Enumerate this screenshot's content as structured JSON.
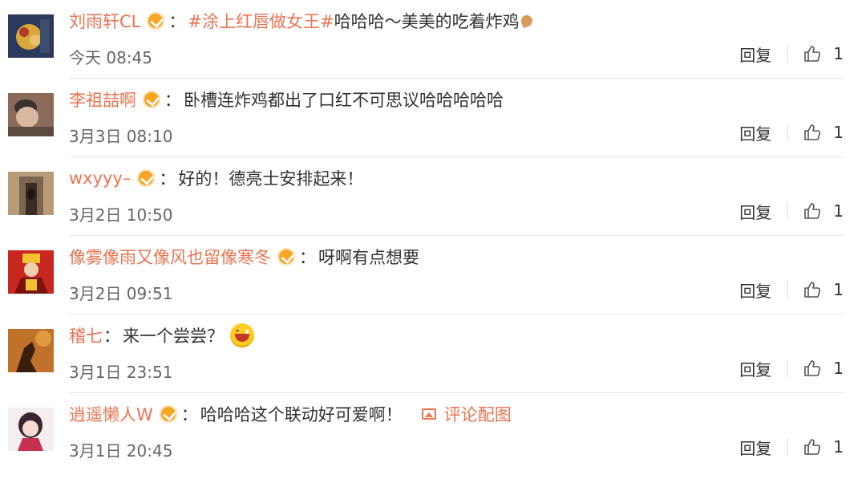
{
  "comments": [
    {
      "user": "刘雨轩CL",
      "topic": "#涂上红唇做女王#",
      "text": "哈哈哈～美美的吃着炸鸡",
      "time": "今天 08:45",
      "reply": "回复",
      "likes": "1",
      "avatar_colors": [
        "#2b3a5c",
        "#d9a63a",
        "#b33a2a"
      ]
    },
    {
      "user": "李祖喆啊",
      "text": "卧槽连炸鸡都出了口红不可思议哈哈哈哈哈",
      "time": "3月3日 08:10",
      "reply": "回复",
      "likes": "1",
      "avatar_colors": [
        "#8a6b5a",
        "#d8b8a0",
        "#3a3030"
      ]
    },
    {
      "user": "wxyyy–",
      "text": "好的！德亮士安排起来！",
      "time": "3月2日 10:50",
      "reply": "回复",
      "likes": "1",
      "avatar_colors": [
        "#7a6650",
        "#3a2c22",
        "#b89c78"
      ]
    },
    {
      "user": "像雾像雨又像风也留像寒冬",
      "text": "呀啊有点想要",
      "time": "3月2日 09:51",
      "reply": "回复",
      "likes": "1",
      "avatar_colors": [
        "#c8261e",
        "#f2c230",
        "#7a1410"
      ]
    },
    {
      "user": "稽七",
      "text": "来一个尝尝？",
      "time": "3月1日 23:51",
      "reply": "回复",
      "likes": "1",
      "avatar_colors": [
        "#c0722a",
        "#3a1e0c",
        "#e09a40"
      ]
    },
    {
      "user": "逍遥懒人W",
      "text": "哈哈哈这个联动好可爱啊！",
      "pic_link": "评论配图",
      "time": "3月1日 20:45",
      "reply": "回复",
      "likes": "1",
      "avatar_colors": [
        "#f4eef0",
        "#3a2430",
        "#c83050"
      ]
    }
  ],
  "colors": {
    "username": "#eb7350",
    "text": "#333333",
    "time": "#666666",
    "divider": "#e6e6e6"
  },
  "icons": {
    "verified": "v-badge-icon",
    "like": "thumbs-up-icon",
    "picture": "picture-icon"
  }
}
